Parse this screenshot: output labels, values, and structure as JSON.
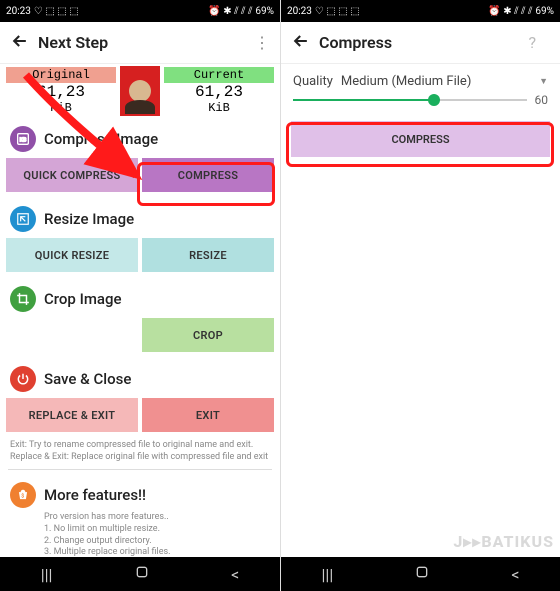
{
  "status": {
    "time": "20:23",
    "battery": "69%",
    "icons": "♡ ⬚ ⬚ ⬚   ⏰ ✱ ⁴ᴳ ⁴ᴳ ⫽"
  },
  "left": {
    "title": "Next Step",
    "original_label": "Original",
    "current_label": "Current",
    "original_size": "61,23",
    "current_size": "61,23",
    "size_unit": "KiB",
    "sections": {
      "compress": {
        "title": "Compress Image",
        "quick": "QUICK COMPRESS",
        "main": "COMPRESS"
      },
      "resize": {
        "title": "Resize Image",
        "quick": "QUICK RESIZE",
        "main": "RESIZE"
      },
      "crop": {
        "title": "Crop Image",
        "main": "CROP"
      },
      "save": {
        "title": "Save & Close",
        "replace": "REPLACE & EXIT",
        "exit": "EXIT",
        "note": "Exit: Try to rename compressed file to original name and exit. Replace & Exit: Replace original file with compressed file and exit"
      },
      "more": {
        "title": "More features!!",
        "intro": "Pro version has more features..",
        "f1": "1. No limit on multiple resize.",
        "f2": "2. Change output directory.",
        "f3": "3. Multiple replace original files."
      }
    }
  },
  "right": {
    "title": "Compress",
    "quality_label": "Quality",
    "quality_value": "Medium (Medium File)",
    "slider_value": "60",
    "button": "COMPRESS"
  },
  "watermark": "J▸▸BATIKUS"
}
